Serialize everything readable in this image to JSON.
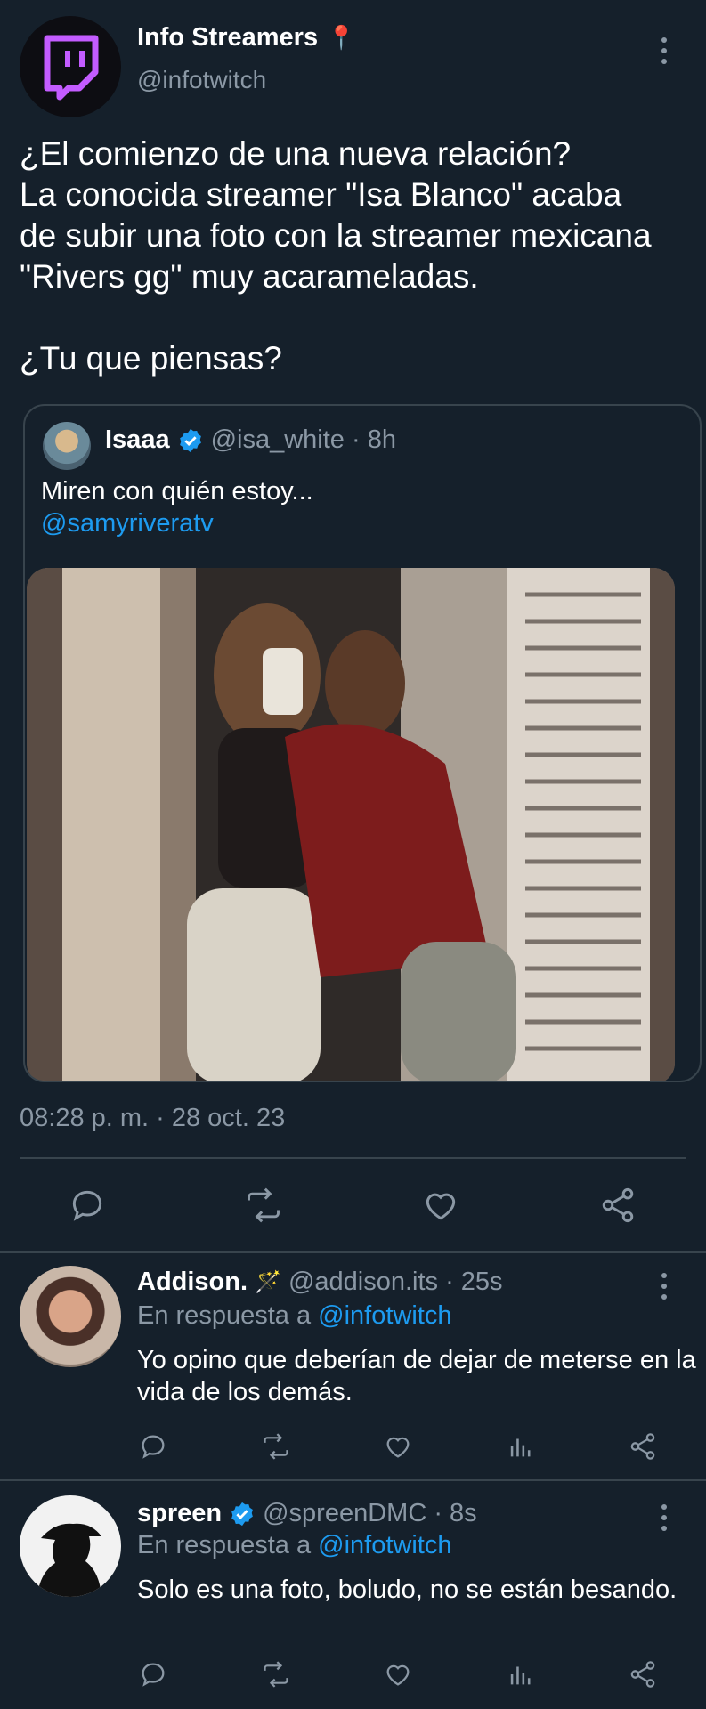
{
  "main_tweet": {
    "author_name": "Info Streamers",
    "author_emoji": "📍",
    "author_handle": "@infotwitch",
    "text_lines": [
      "¿El comienzo de una nueva relación?",
      "La conocida streamer \"Isa Blanco\" acaba",
      "de subir una foto con la streamer mexicana",
      "\"Rivers gg\" muy acarameladas."
    ],
    "question": "¿Tu que piensas?",
    "timestamp": "08:28 p. m. · 28 oct. 23"
  },
  "quoted_tweet": {
    "author_name": "Isaaa",
    "verified": true,
    "meta": "@isa_white · 8h",
    "text": "Miren con quién estoy...",
    "mention": "@samyriveratv"
  },
  "replies": [
    {
      "author_name": "Addison.",
      "author_emoji": "🪄",
      "meta": "@addison.its · 25s",
      "reply_prefix": "En respuesta a",
      "reply_to": "@infotwitch",
      "text": "Yo opino que deberían de dejar de meterse en la vida de los demás.",
      "verified": false
    },
    {
      "author_name": "spreen",
      "author_emoji": "",
      "meta": "@spreenDMC · 8s",
      "reply_prefix": "En respuesta a",
      "reply_to": "@infotwitch",
      "text": "Solo es una foto, boludo, no se están besando.",
      "verified": true
    }
  ],
  "colors": {
    "background": "#15202b",
    "text": "#e7e9ea",
    "muted": "#8b98a5",
    "link": "#1d9bf0",
    "border": "#38444d",
    "twitch_purple": "#b44cff"
  },
  "icons": [
    "twitch-logo-icon",
    "pin-icon",
    "more-icon",
    "verified-icon",
    "reply-icon",
    "retweet-icon",
    "like-icon",
    "share-icon",
    "views-icon"
  ]
}
